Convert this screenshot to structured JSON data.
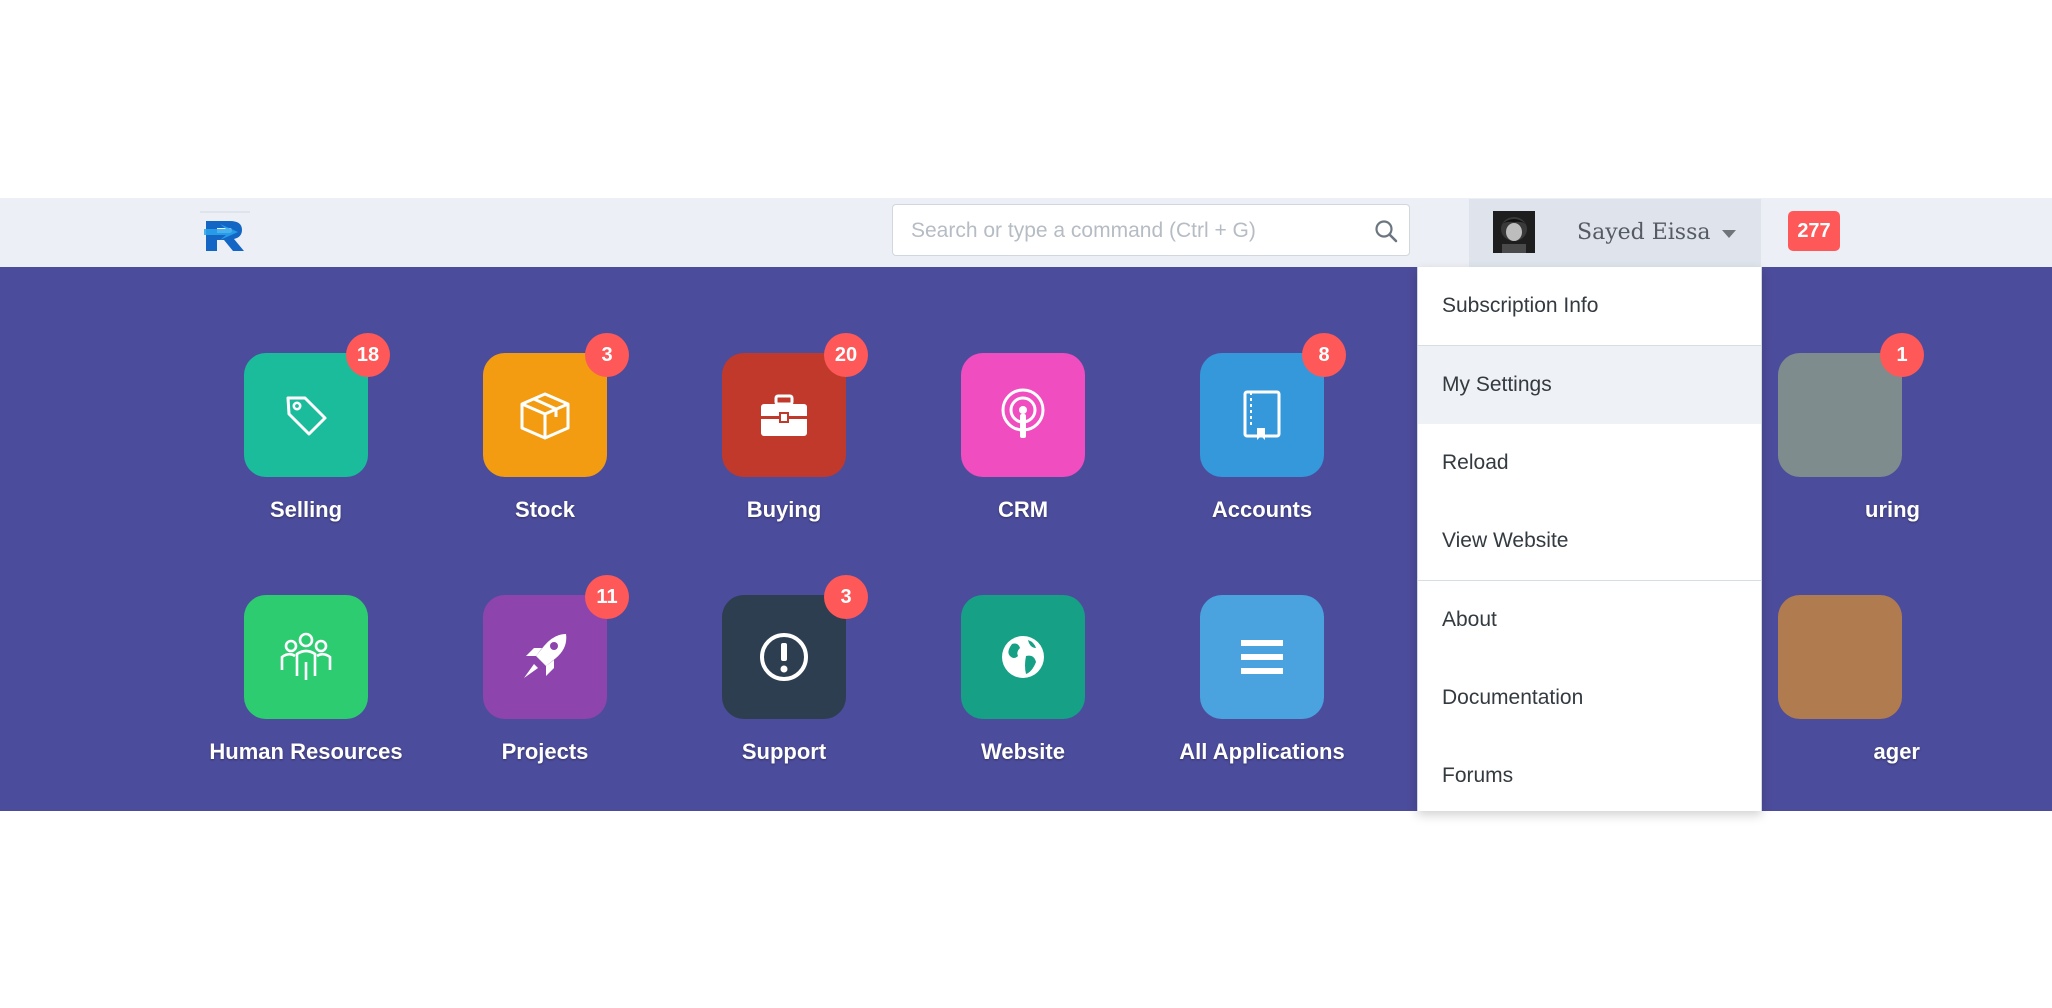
{
  "navbar": {
    "logo_icon": "brand-r-logo-icon",
    "search": {
      "placeholder": "Search or type a command (Ctrl + G)",
      "icon": "search-icon"
    },
    "user": {
      "name": "Sayed Eissa",
      "avatar_icon": "user-avatar"
    },
    "notifications_count": "277"
  },
  "desktop": {
    "background": "#4c4c9c",
    "apps": [
      {
        "label": "Selling",
        "badge": "18",
        "icon": "tag-icon",
        "color": "#1abc9c"
      },
      {
        "label": "Stock",
        "badge": "3",
        "icon": "box-icon",
        "color": "#f39c12"
      },
      {
        "label": "Buying",
        "badge": "20",
        "icon": "briefcase-icon",
        "color": "#c0392b"
      },
      {
        "label": "CRM",
        "badge": "",
        "icon": "broadcast-icon",
        "color": "#f04dc0"
      },
      {
        "label": "Accounts",
        "badge": "8",
        "icon": "ledger-book-icon",
        "color": "#3498db"
      },
      {
        "label": "uring",
        "badge": "1",
        "icon": "manufacturing-icon",
        "color": "#7f8c8d"
      },
      {
        "label": "Human Resources",
        "badge": "",
        "icon": "people-icon",
        "color": "#2ecc71"
      },
      {
        "label": "Projects",
        "badge": "11",
        "icon": "rocket-icon",
        "color": "#8e44ad"
      },
      {
        "label": "Support",
        "badge": "3",
        "icon": "exclamation-icon",
        "color": "#2c3e50"
      },
      {
        "label": "Website",
        "badge": "",
        "icon": "globe-icon",
        "color": "#16a085"
      },
      {
        "label": "All Applications",
        "badge": "",
        "icon": "list-icon",
        "color": "#4aa3df"
      },
      {
        "label": "ager",
        "badge": "",
        "icon": "file-manager-icon",
        "color": "#b07c4f"
      }
    ]
  },
  "user_dropdown": {
    "items": [
      {
        "label": "Subscription Info"
      },
      {
        "label": "My Settings"
      },
      {
        "label": "Reload"
      },
      {
        "label": "View Website"
      },
      {
        "label": "About"
      },
      {
        "label": "Documentation"
      },
      {
        "label": "Forums"
      }
    ]
  }
}
